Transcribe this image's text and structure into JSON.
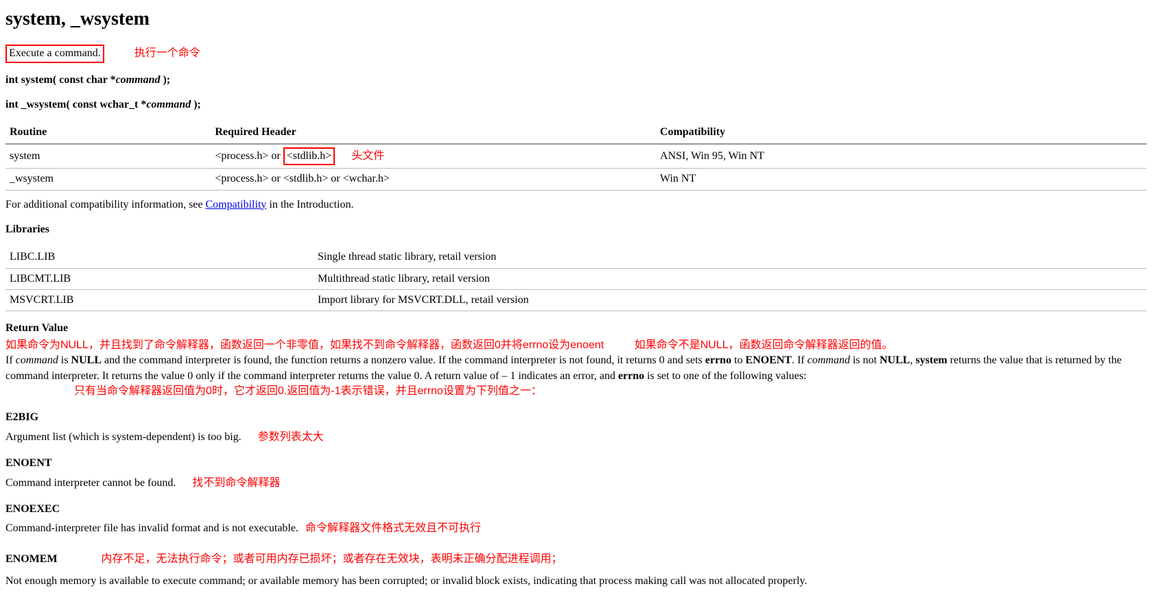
{
  "title": "system, _wsystem",
  "intro": {
    "boxed": "Execute a command.",
    "annotation": "执行一个命令"
  },
  "signatures": {
    "sig1_pre": "int system( const char *",
    "sig1_param": "command",
    "sig1_post": " );",
    "sig2_pre": "int _wsystem( const wchar_t *",
    "sig2_param": "command",
    "sig2_post": " );"
  },
  "req_table": {
    "headers": {
      "routine": "Routine",
      "header": "Required Header",
      "compat": "Compatibility"
    },
    "rows": [
      {
        "routine": "system",
        "header_pre": "<process.h> or ",
        "header_box": "<stdlib.h>",
        "header_post": "",
        "annot": "头文件",
        "compat": "ANSI, Win 95, Win NT"
      },
      {
        "routine": "_wsystem",
        "header_pre": "<process.h> or <stdlib.h> or <wchar.h>",
        "header_box": "",
        "header_post": "",
        "annot": "",
        "compat": "Win NT"
      }
    ]
  },
  "compat_line": {
    "pre": "For additional compatibility information, see ",
    "link": "Compatibility",
    "post": " in the Introduction."
  },
  "libraries": {
    "title": "Libraries",
    "rows": [
      {
        "lib": "LIBC.LIB",
        "desc": "Single thread static library, retail version"
      },
      {
        "lib": "LIBCMT.LIB",
        "desc": "Multithread static library, retail version"
      },
      {
        "lib": "MSVCRT.LIB",
        "desc": "Import library for MSVCRT.DLL, retail version"
      }
    ]
  },
  "return_value": {
    "title": "Return Value",
    "annot_line1a": "如果命令为NULL，并且找到了命令解释器，函数返回一个非零值，如果找不到命令解释器，函数返回0并将errno设为enoent",
    "annot_line1b": "如果命令不是NULL，函数返回命令解释器返回的值。",
    "para_p1": "If ",
    "para_i1": "command",
    "para_p2": " is ",
    "para_b1": "NULL",
    "para_p3": " and the command interpreter is found, the function returns a nonzero value. If the command interpreter is not found, it returns 0 and sets ",
    "para_b2": "errno",
    "para_p4": " to ",
    "para_b3": "ENOENT",
    "para_p5": ". If ",
    "para_i2": "command",
    "para_p6": " is not ",
    "para_b4": "NULL",
    "para_p7": ", ",
    "para_b5": "system",
    "para_p8": " returns the value that is returned by the command interpreter. It returns the value 0 only if the command interpreter returns the value 0. A return value of – 1 indicates an error, and ",
    "para_b6": "errno",
    "para_p9": " is set to one of the following values:",
    "annot_line2": "只有当命令解释器返回值为0时，它才返回0.返回值为-1表示错误，并且errno设置为下列值之一："
  },
  "errors": {
    "e2big": {
      "name": "E2BIG",
      "desc": "Argument list (which is system-dependent) is too big.",
      "annot": "参数列表太大"
    },
    "enoent": {
      "name": "ENOENT",
      "desc": "Command interpreter cannot be found.",
      "annot": "找不到命令解释器"
    },
    "enoexec": {
      "name": "ENOEXEC",
      "desc": "Command-interpreter file has invalid format and is not executable.",
      "annot": "命令解释器文件格式无效且不可执行"
    },
    "enomem": {
      "name": "ENOMEM",
      "annot": "内存不足，无法执行命令；或者可用内存已损坏；或者存在无效块，表明未正确分配进程调用；",
      "desc": "Not enough memory is available to execute command; or available memory has been corrupted; or invalid block exists, indicating that process making call was not allocated properly."
    }
  }
}
